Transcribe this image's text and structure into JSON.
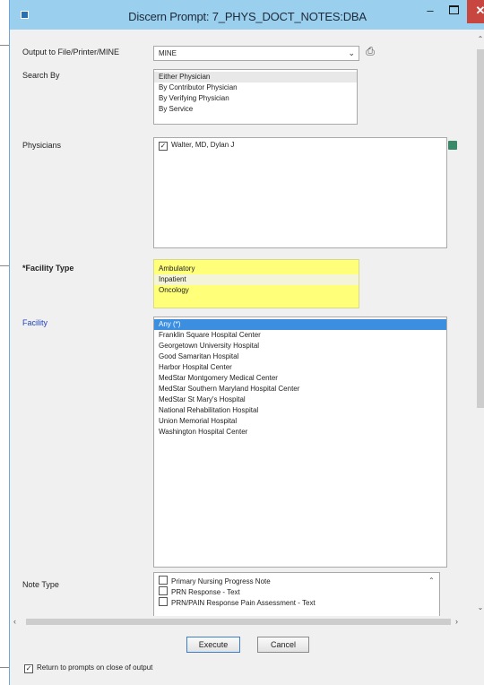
{
  "window": {
    "title": "Discern Prompt: 7_PHYS_DOCT_NOTES:DBA",
    "min_label": "–",
    "close_label": "✕"
  },
  "output": {
    "label": "Output to File/Printer/MINE",
    "value": "MINE",
    "arrow": "⌄"
  },
  "search_by": {
    "label": "Search By",
    "options": [
      "Either Physician",
      "By Contributor Physician",
      "By Verifying Physician",
      "By Service"
    ],
    "selected": "Either Physician"
  },
  "physicians": {
    "label": "Physicians",
    "items": [
      {
        "label": "Walter, MD, Dylan J",
        "checked": true
      }
    ]
  },
  "facility_type": {
    "label": "*Facility Type",
    "options": [
      "Ambulatory",
      "Inpatient",
      "Oncology"
    ],
    "selected": "Inpatient"
  },
  "facility": {
    "label": "Facility",
    "options": [
      "Any (*)",
      "Franklin Square Hospital Center",
      "Georgetown University Hospital",
      "Good Samaritan Hospital",
      "Harbor Hospital Center",
      "MedStar Montgomery Medical Center",
      "MedStar Southern Maryland Hospital Center",
      "MedStar St Mary's Hospital",
      "National Rehabilitation Hospital",
      "Union Memorial Hospital",
      "Washington Hospital Center"
    ],
    "selected": "Any (*)"
  },
  "note_type": {
    "label": "Note Type",
    "items": [
      "Primary Nursing Progress Note",
      "PRN Response - Text",
      "PRN/PAIN Response Pain Assessment - Text"
    ]
  },
  "buttons": {
    "execute": "Execute",
    "cancel": "Cancel"
  },
  "return_prompts": {
    "label": "Return to prompts on close of output",
    "checked": true
  },
  "colors": {
    "titlebar": "#9bcfee",
    "close": "#c7463f",
    "required_highlight": "#ffff7a",
    "selection": "#3c8fe0",
    "facility_label": "#2244bb"
  },
  "icons": {
    "printer": "printer-icon",
    "address_book": "address-book-icon"
  }
}
